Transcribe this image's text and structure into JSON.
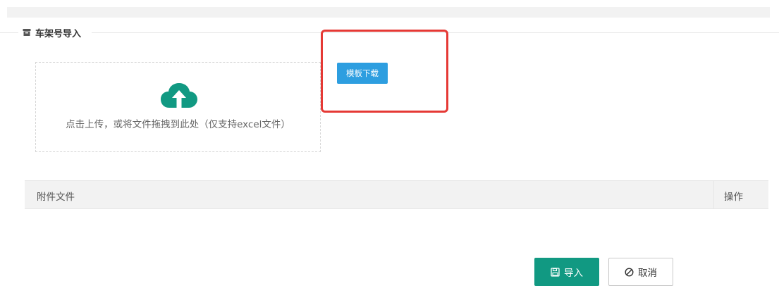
{
  "section": {
    "title": "车架号导入",
    "icon": "archive-icon"
  },
  "upload": {
    "hint": "点击上传，或将文件拖拽到此处（仅支持excel文件）",
    "icon": "cloud-upload-icon",
    "icon_color": "#119982"
  },
  "template_button": {
    "label": "模板下载",
    "color": "#2d9ee0"
  },
  "table": {
    "columns": [
      "附件文件",
      "操作"
    ],
    "rows": []
  },
  "actions": {
    "import_label": "导入",
    "import_icon": "save-icon",
    "import_color": "#119982",
    "cancel_label": "取消",
    "cancel_icon": "ban-icon"
  },
  "annotation": {
    "color": "#e53935"
  }
}
